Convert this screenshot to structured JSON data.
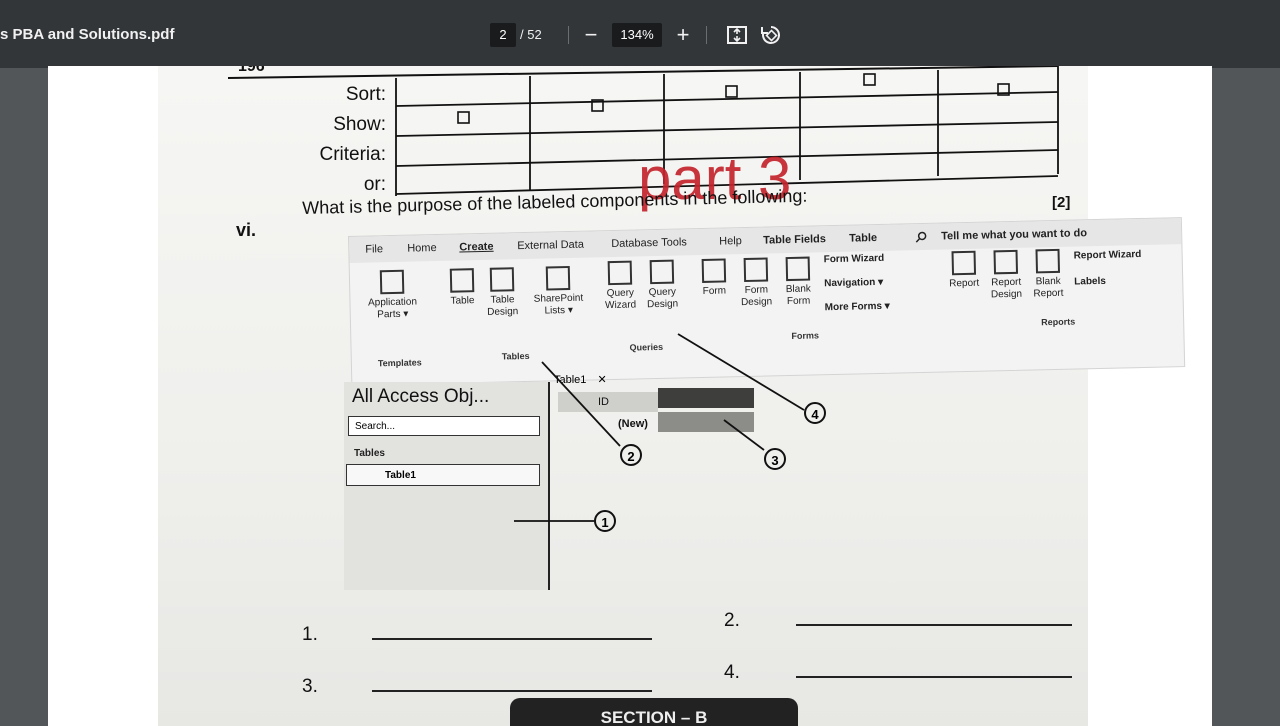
{
  "toolbar": {
    "doc_title": "s PBA and Solutions.pdf",
    "current_page": "2",
    "total_pages": "/ 52",
    "zoom": "134%",
    "zoom_out_symbol": "−",
    "zoom_in_symbol": "+",
    "icons": [
      "fit-page-icon",
      "rotate-icon"
    ]
  },
  "document": {
    "fragment_top": "196",
    "grid_labels": [
      "Sort:",
      "Show:",
      "Criteria:",
      "or:"
    ],
    "question_mark": "[2]",
    "question_number": "vi.",
    "question_text": "What is the purpose of the labeled components in the following:",
    "watermark": "part 3",
    "ribbon": {
      "tabs": [
        "File",
        "Home",
        "Create",
        "External Data",
        "Database Tools",
        "Help",
        "Table Fields",
        "Table"
      ],
      "tell_me": "Tell me what you want to do",
      "groups": [
        "Templates",
        "Tables",
        "Queries",
        "Forms",
        "Reports"
      ],
      "buttons": {
        "application_parts": "Application Parts ▾",
        "table": "Table",
        "table_design": "Table Design",
        "sharepoint_lists": "SharePoint Lists ▾",
        "query_wizard": "Query Wizard",
        "query_design": "Query Design",
        "form": "Form",
        "form_design": "Form Design",
        "blank_form": "Blank Form",
        "form_wizard": "Form Wizard",
        "navigation": "Navigation ▾",
        "more_forms": "More Forms ▾",
        "report": "Report",
        "report_design": "Report Design",
        "blank_report": "Blank Report",
        "report_wizard": "Report Wizard",
        "labels": "Labels"
      }
    },
    "nav_pane": {
      "title": "All Access Obj...",
      "search_placeholder": "Search...",
      "category": "Tables",
      "item": "Table1"
    },
    "datasheet": {
      "tab": "Table1",
      "close": "✕",
      "column": "ID",
      "new_row": "(New)"
    },
    "callouts": [
      "1",
      "2",
      "3",
      "4"
    ],
    "answers": [
      "1.",
      "2.",
      "3.",
      "4."
    ],
    "section_label": "SECTION – B"
  }
}
